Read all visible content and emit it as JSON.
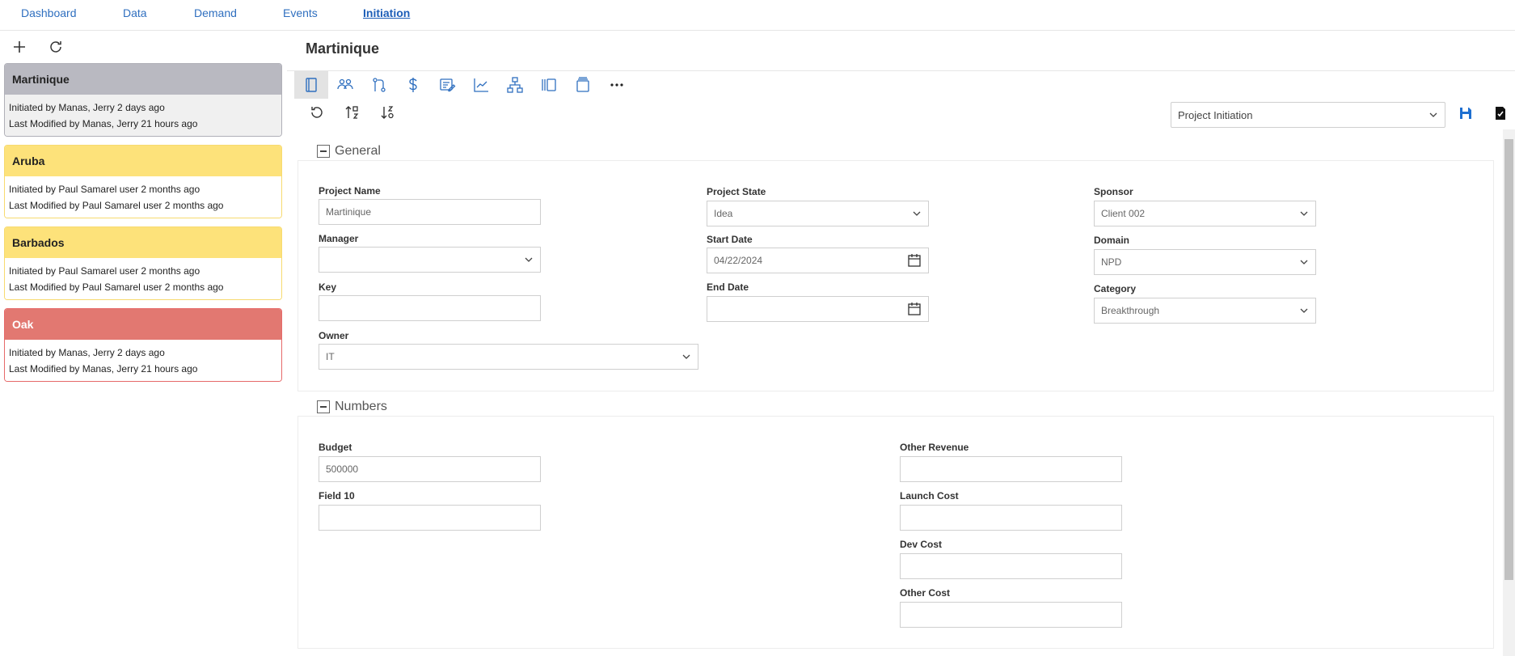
{
  "nav": {
    "items": [
      "Dashboard",
      "Data",
      "Demand",
      "Events",
      "Initiation"
    ],
    "active": "Initiation"
  },
  "left_toolbar": {
    "icons": [
      "plus-icon",
      "refresh-icon"
    ]
  },
  "projects": [
    {
      "name": "Martinique",
      "initiated": "Initiated by Manas, Jerry 2 days ago",
      "modified": "Last Modified by Manas, Jerry 21 hours ago",
      "color": "selected"
    },
    {
      "name": "Aruba",
      "initiated": "Initiated by Paul Samarel user 2 months ago",
      "modified": "Last Modified by Paul Samarel user 2 months ago",
      "color": "yellow"
    },
    {
      "name": "Barbados",
      "initiated": "Initiated by Paul Samarel user 2 months ago",
      "modified": "Last Modified by Paul Samarel user 2 months ago",
      "color": "yellow"
    },
    {
      "name": "Oak",
      "initiated": "Initiated by Manas, Jerry 2 days ago",
      "modified": "Last Modified by Manas, Jerry 21 hours ago",
      "color": "red"
    }
  ],
  "main": {
    "title": "Martinique",
    "view_select": "Project Initiation",
    "toolbar_icons": [
      "form-icon",
      "team-icon",
      "workflow-icon",
      "dollar-icon",
      "edit-list-icon",
      "chart-icon",
      "hierarchy-icon",
      "columns-icon",
      "stack-icon",
      "more-icon"
    ],
    "subbar_icons": [
      "undo-icon",
      "sort-ascending-icon",
      "sort-descending-icon"
    ]
  },
  "general": {
    "title": "General",
    "project_name": {
      "label": "Project Name",
      "value": "Martinique"
    },
    "manager": {
      "label": "Manager",
      "value": ""
    },
    "key": {
      "label": "Key",
      "value": ""
    },
    "owner": {
      "label": "Owner",
      "value": "IT"
    },
    "project_state": {
      "label": "Project State",
      "value": "Idea"
    },
    "start_date": {
      "label": "Start Date",
      "value": "04/22/2024"
    },
    "end_date": {
      "label": "End Date",
      "value": ""
    },
    "sponsor": {
      "label": "Sponsor",
      "value": "Client 002"
    },
    "domain": {
      "label": "Domain",
      "value": "NPD"
    },
    "category": {
      "label": "Category",
      "value": "Breakthrough"
    }
  },
  "numbers": {
    "title": "Numbers",
    "budget": {
      "label": "Budget",
      "value": "500000"
    },
    "field10": {
      "label": "Field 10",
      "value": ""
    },
    "other_revenue": {
      "label": "Other Revenue",
      "value": ""
    },
    "launch_cost": {
      "label": "Launch Cost",
      "value": ""
    },
    "dev_cost": {
      "label": "Dev Cost",
      "value": ""
    },
    "other_cost": {
      "label": "Other Cost",
      "value": ""
    }
  },
  "colors": {
    "accent": "#2f6fbf",
    "yellow": "#fde27a",
    "red": "#e27871",
    "selected": "#b9b9c1"
  }
}
